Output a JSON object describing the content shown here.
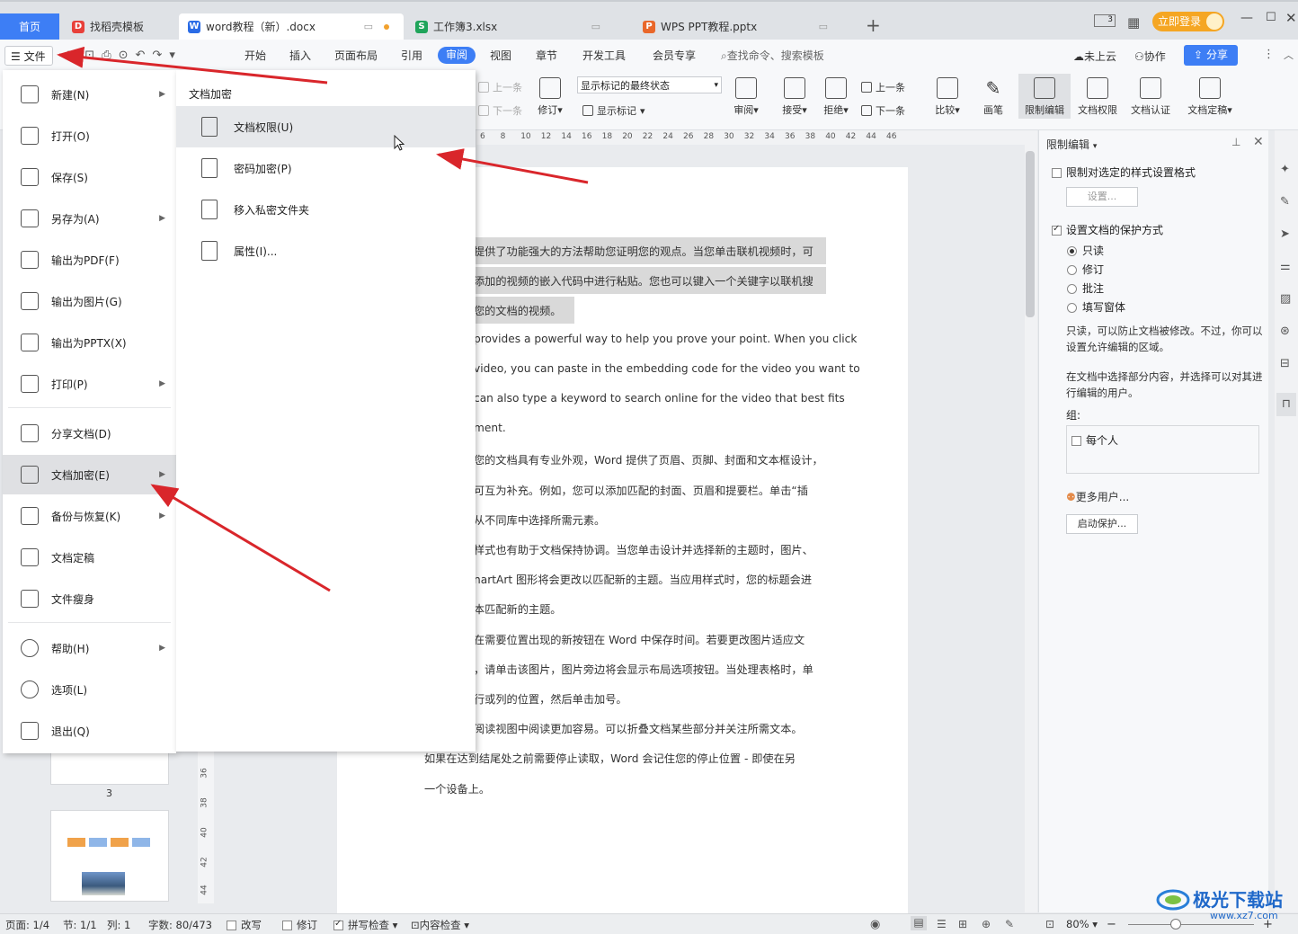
{
  "tabs": {
    "home": "首页",
    "template": "找稻壳模板",
    "doc": "word教程（新）.docx",
    "xls": "工作簿3.xlsx",
    "ppt": "WPS PPT教程.pptx",
    "add": "+"
  },
  "window": {
    "login": "立即登录",
    "view_badge": "3"
  },
  "ribbon_tabs": [
    "开始",
    "插入",
    "页面布局",
    "引用",
    "审阅",
    "视图",
    "章节",
    "开发工具",
    "会员专享"
  ],
  "ribbon_active_tab": "审阅",
  "file_button": "文件",
  "search_placeholder": "查找命令、搜索模板",
  "top_right": {
    "cloud": "未上云",
    "collab": "协作",
    "share": "分享"
  },
  "review_ribbon": {
    "prev_comment": "上一条",
    "next_comment": "下一条",
    "revise": "修订",
    "markup_mode": "显示标记的最终状态",
    "show_markup": "显示标记",
    "review": "审阅",
    "accept": "接受",
    "reject": "拒绝",
    "prev": "上一条",
    "next": "下一条",
    "compare": "比较",
    "pen": "画笔",
    "restrict": "限制编辑",
    "doc_rights": "文档权限",
    "doc_cert": "文档认证",
    "doc_final": "文档定稿"
  },
  "ruler_ticks": [
    "6",
    "8",
    "10",
    "12",
    "14",
    "16",
    "18",
    "20",
    "22",
    "24",
    "26",
    "28",
    "30",
    "32",
    "34",
    "36",
    "38",
    "40",
    "42",
    "44",
    "46"
  ],
  "file_menu": [
    {
      "label": "新建(N)",
      "arrow": true
    },
    {
      "label": "打开(O)",
      "arrow": false
    },
    {
      "label": "保存(S)",
      "arrow": false
    },
    {
      "label": "另存为(A)",
      "arrow": true
    },
    {
      "label": "输出为PDF(F)",
      "arrow": false
    },
    {
      "label": "输出为图片(G)",
      "arrow": false
    },
    {
      "label": "输出为PPTX(X)",
      "arrow": false
    },
    {
      "label": "打印(P)",
      "arrow": true
    },
    {
      "label": "分享文档(D)",
      "arrow": false
    },
    {
      "label": "文档加密(E)",
      "arrow": true
    },
    {
      "label": "备份与恢复(K)",
      "arrow": true
    },
    {
      "label": "文档定稿",
      "arrow": false
    },
    {
      "label": "文件瘦身",
      "arrow": false
    },
    {
      "label": "帮助(H)",
      "arrow": true
    },
    {
      "label": "选项(L)",
      "arrow": false
    },
    {
      "label": "退出(Q)",
      "arrow": false
    }
  ],
  "submenu": {
    "title": "文档加密",
    "items": [
      "文档权限(U)",
      "密码加密(P)",
      "移入私密文件夹",
      "属性(I)..."
    ]
  },
  "doc_lines": [
    "提供了功能强大的方法帮助您证明您的观点。当您单击联机视频时，可",
    "添加的视频的嵌入代码中进行粘贴。您也可以键入一个关键字以联机搜",
    "您的文档的视频。",
    "provides a powerful way to help you prove your point. When you click",
    "video, you can paste in the embedding code for the video you want to",
    "can also type a keyword to search online for the video that best fits",
    "ment.",
    "您的文档具有专业外观，Word 提供了页眉、页脚、封面和文本框设计，",
    "可互为补充。例如，您可以添加匹配的封面、页眉和提要栏。单击“插",
    "从不同库中选择所需元素。",
    "样式也有助于文档保持协调。当您单击设计并选择新的主题时，图片、",
    "nartArt 图形将会更改以匹配新的主题。当应用样式时，您的标题会进",
    "本匹配新的主题。",
    "在需要位置出现的新按钮在 Word 中保存时间。若要更改图片适应文",
    "，请单击该图片，图片旁边将会显示布局选项按钮。当处理表格时，单",
    "行或列的位置，然后单击加号。",
    "阅读视图中阅读更加容易。可以折叠文档某些部分并关注所需文本。",
    "如果在达到结尾处之前需要停止读取，Word 会记住您的停止位置 - 即使在另",
    "一个设备上。"
  ],
  "thumb_page_number": "3",
  "vertical_ruler": [
    "36",
    "38",
    "40",
    "42",
    "44"
  ],
  "restrict_panel": {
    "title": "限制编辑",
    "opt1": "限制对选定的样式设置格式",
    "settings_btn": "设置...",
    "opt2": "设置文档的保护方式",
    "modes": [
      "只读",
      "修订",
      "批注",
      "填写窗体"
    ],
    "selected_mode": "只读",
    "desc1": "只读，可以防止文档被修改。不过，你可以设置允许编辑的区域。",
    "desc2": "在文档中选择部分内容，并选择可以对其进行编辑的用户。",
    "group_label": "组:",
    "everyone": "每个人",
    "more_users": "更多用户...",
    "start_btn": "启动保护..."
  },
  "status_bar": {
    "page": "页面: 1/4",
    "section": "节: 1/1",
    "col": "列: 1",
    "words": "字数: 80/473",
    "edit": "改写",
    "revise": "修订",
    "spell": "拼写检查",
    "content": "内容检查",
    "zoom": "80%"
  },
  "watermark": {
    "main": "极光下载站",
    "url": "www.xz7.com"
  },
  "colors": {
    "accent": "#3d7ef5",
    "arrow": "#d9262b",
    "login": "#f5a623"
  }
}
